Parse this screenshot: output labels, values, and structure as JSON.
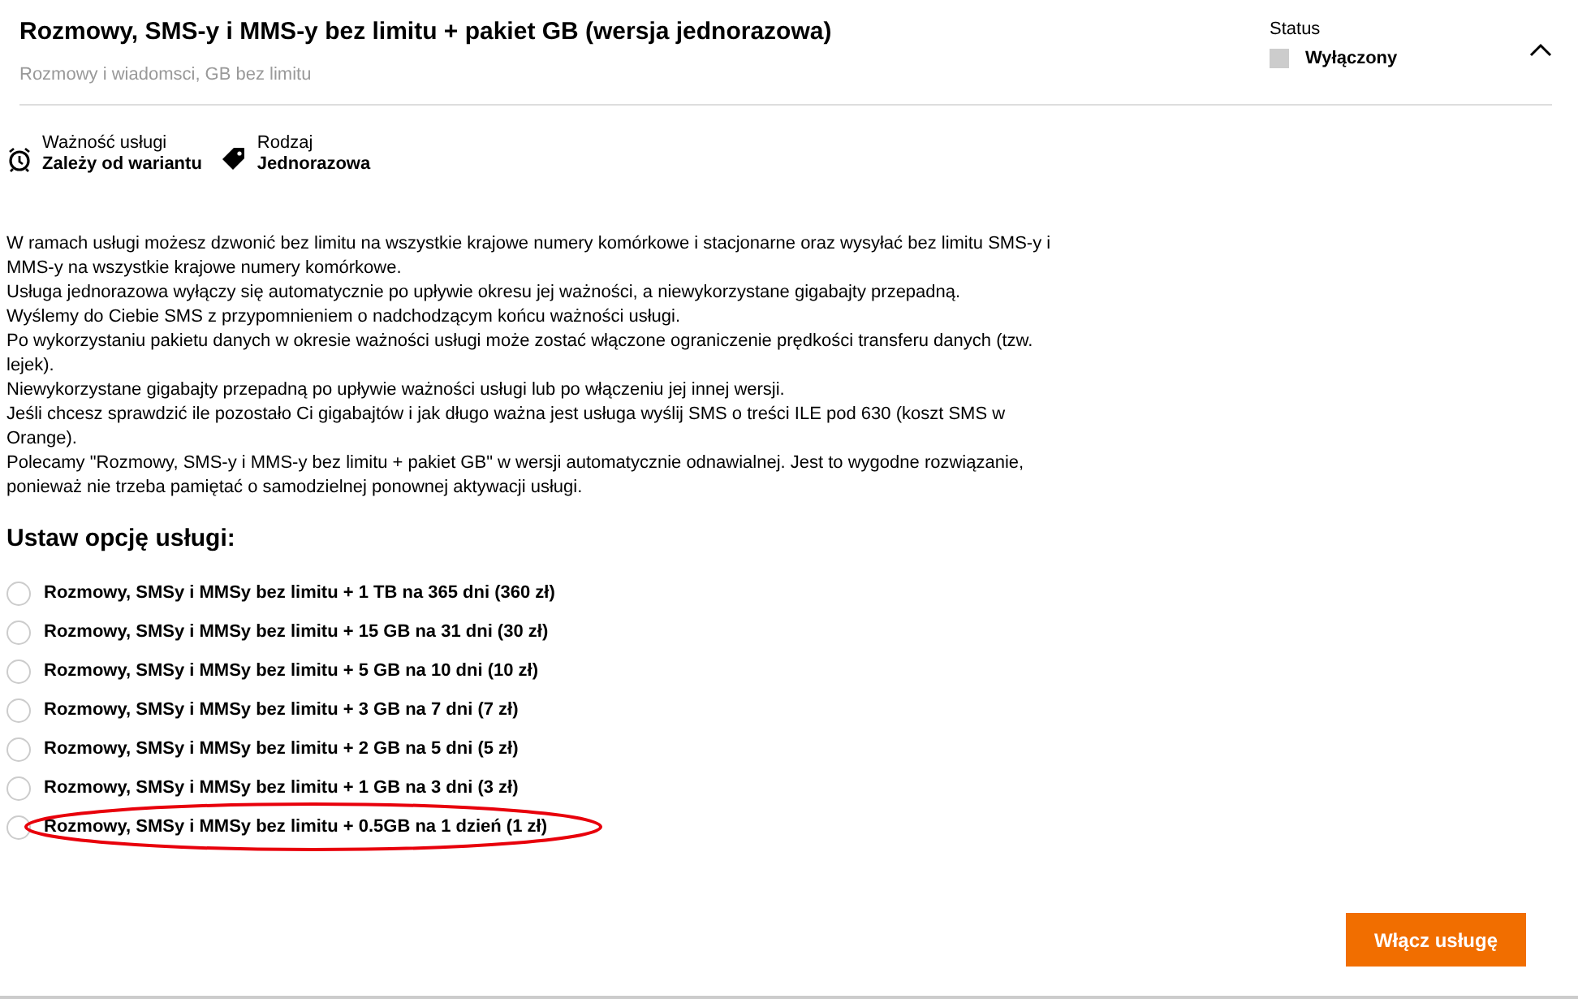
{
  "header": {
    "title": "Rozmowy, SMS-y i MMS-y bez limitu + pakiet GB (wersja jednorazowa)",
    "subtitle": "Rozmowy i wiadomsci, GB bez limitu",
    "status_label": "Status",
    "status": {
      "on": false,
      "text": "Wyłączony"
    },
    "expanded": true
  },
  "facts": [
    {
      "kind": "clock",
      "label": "Ważność usługi",
      "value": "Zależy od wariantu"
    },
    {
      "kind": "tag",
      "label": "Rodzaj",
      "value": "Jednorazowa"
    }
  ],
  "description": [
    "W ramach usługi możesz dzwonić bez limitu na wszystkie krajowe numery komórkowe i stacjonarne oraz wysyłać bez limitu SMS-y i MMS-y na wszystkie krajowe numery komórkowe.",
    "Usługa jednorazowa wyłączy się automatycznie po upływie okresu jej ważności, a niewykorzystane gigabajty przepadną.",
    "Wyślemy do Ciebie SMS z przypomnieniem o nadchodzącym końcu ważności usługi.",
    "Po wykorzystaniu pakietu danych w okresie ważności usługi może zostać włączone ograniczenie prędkości transferu danych (tzw. lejek).",
    "Niewykorzystane gigabajty przepadną po upływie ważności usługi lub po włączeniu jej innej wersji.",
    "Jeśli chcesz sprawdzić ile pozostało Ci gigabajtów i jak długo ważna jest usługa wyślij SMS o treści ILE pod 630 (koszt SMS w Orange).",
    "Polecamy \"Rozmowy, SMS-y i MMS-y bez limitu + pakiet GB\" w wersji automatycznie odnawialnej. Jest to wygodne rozwiązanie, ponieważ nie trzeba pamiętać o samodzielnej ponownej aktywacji usługi."
  ],
  "options_heading": "Ustaw opcję usługi:",
  "options": [
    {
      "label": "Rozmowy, SMSy i MMSy bez limitu + 1 TB na 365 dni (360 zł)",
      "selected": false,
      "circled": false
    },
    {
      "label": "Rozmowy, SMSy i MMSy bez limitu + 15 GB na 31 dni (30 zł)",
      "selected": false,
      "circled": false
    },
    {
      "label": "Rozmowy, SMSy i MMSy bez limitu + 5 GB na 10 dni (10 zł)",
      "selected": false,
      "circled": false
    },
    {
      "label": "Rozmowy, SMSy i MMSy bez limitu + 3 GB na 7 dni (7 zł)",
      "selected": false,
      "circled": false
    },
    {
      "label": "Rozmowy, SMSy i MMSy bez limitu + 2 GB na 5 dni (5 zł)",
      "selected": false,
      "circled": false
    },
    {
      "label": "Rozmowy, SMSy i MMSy bez limitu + 1 GB na 3 dni (3 zł)",
      "selected": false,
      "circled": false
    },
    {
      "label": "Rozmowy, SMSy i MMSy bez limitu + 0.5GB na 1 dzień (1 zł)",
      "selected": false,
      "circled": true
    }
  ],
  "submit_button": "Włącz usługę"
}
